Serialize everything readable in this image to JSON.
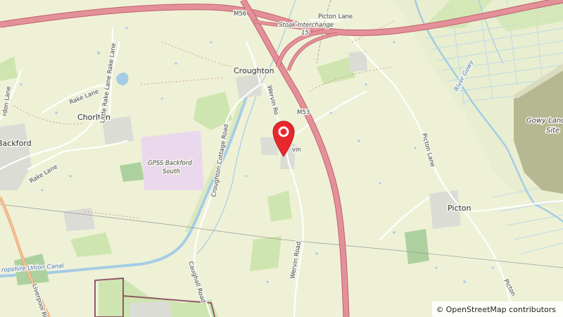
{
  "map": {
    "attribution": {
      "symbol": "©",
      "text": "OpenStreetMap contributors"
    },
    "colors": {
      "background": "#eef1d6",
      "motorway": "#e4909a",
      "motorway_casing": "#c1606a",
      "water": "#a5cce6",
      "residential": "#e0dfdf",
      "industrial": "#ead9ec",
      "landfill": "#b6b891",
      "wood": "#add19e",
      "marker": "#e8282d"
    },
    "labels": {
      "croughton": "Croughton",
      "chorlton": "Chorlton",
      "backford": "Backford",
      "picton": "Picton",
      "stoak_interchange": "Stoak Interchange",
      "junction_15": "15",
      "m56": "M56",
      "m53": "M53",
      "picton_lane_top": "Picton Lane",
      "picton_lane_east": "Picton Lane",
      "picton_bottom": "Picton",
      "rake_lane_top": "Rake Lane",
      "rake_lane_mid": "Rake Lane",
      "rake_lane_west": "Rake Lane",
      "little_rake_lane": "Little Rake Lane",
      "croughton_cottage_road": "Croughton Cottage Road",
      "caughall_road": "Caughall Road",
      "wervin_road_upper": "Wervin Ro",
      "wervin_road_lower": "Wervin Road",
      "wervin_place": "vin",
      "gpss": "GPSS Backford",
      "gpss_south": "South",
      "shropshire_union_canal": "ropshire Union Canal",
      "river_gowy": "River Gowy",
      "gowy_landfill": "Gowy Landfill",
      "gowy_landfill_site": "Site",
      "liverpool_road": "Liverpool Ro",
      "acton_lane": "rdon Lane"
    },
    "marker": {
      "icon": "location-pin-icon"
    }
  }
}
